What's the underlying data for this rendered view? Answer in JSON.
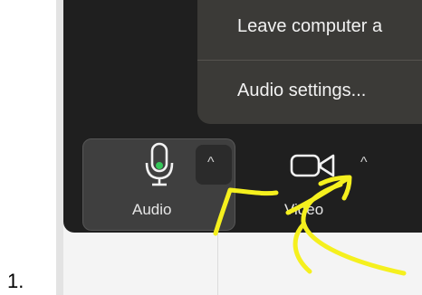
{
  "step": {
    "number": "1."
  },
  "menu": {
    "items": [
      {
        "label": "Leave computer a"
      },
      {
        "label": "Audio settings..."
      }
    ]
  },
  "toolbar": {
    "audio_label": "Audio",
    "video_label": "Video",
    "audio_chevron": "^",
    "video_chevron": "^"
  },
  "icons": {
    "microphone": "microphone-icon",
    "camera": "video-camera-icon",
    "chevron": "chevron-up-icon"
  },
  "colors": {
    "toolbar_bg": "#1f1f1f",
    "menu_bg": "#3b3a37",
    "audio_button_bg": "#3f3f3f",
    "mic_level": "#34c759",
    "annotation": "#f5f01e"
  }
}
